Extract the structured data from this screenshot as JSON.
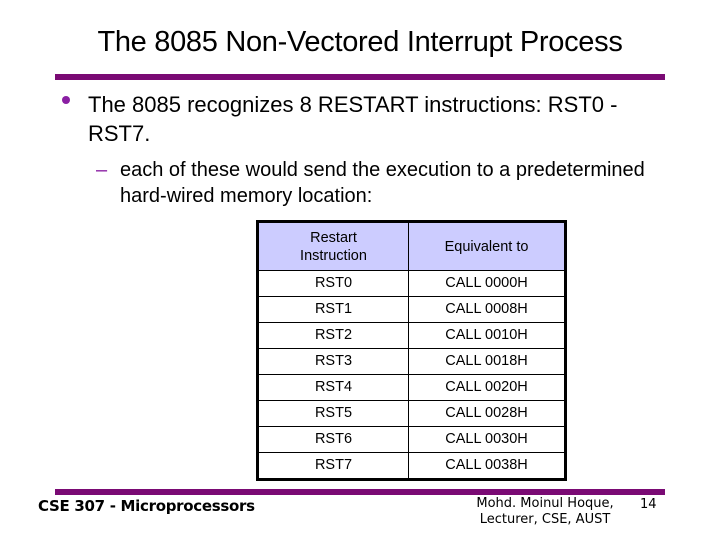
{
  "slide": {
    "title": "The 8085 Non-Vectored Interrupt Process",
    "accent_color": "#7a0a74",
    "bullet": "The 8085 recognizes 8 RESTART instructions: RST0 - RST7.",
    "sub_bullet_marker": "–",
    "sub_bullet": "each of these would send the execution to a predetermined hard-wired memory location:",
    "table": {
      "headers": [
        "Restart Instruction",
        "Equivalent to"
      ],
      "header_color": "#ccccff",
      "rows": [
        [
          "RST0",
          "CALL 0000H"
        ],
        [
          "RST1",
          "CALL 0008H"
        ],
        [
          "RST2",
          "CALL 0010H"
        ],
        [
          "RST3",
          "CALL 0018H"
        ],
        [
          "RST4",
          "CALL 0020H"
        ],
        [
          "RST5",
          "CALL 0028H"
        ],
        [
          "RST6",
          "CALL 0030H"
        ],
        [
          "RST7",
          "CALL 0038H"
        ]
      ]
    },
    "footer": {
      "course": "CSE 307 - Microprocessors",
      "author_line1": "Mohd. Moinul Hoque,",
      "author_line2": "Lecturer, CSE, AUST",
      "page_number": "14"
    }
  }
}
